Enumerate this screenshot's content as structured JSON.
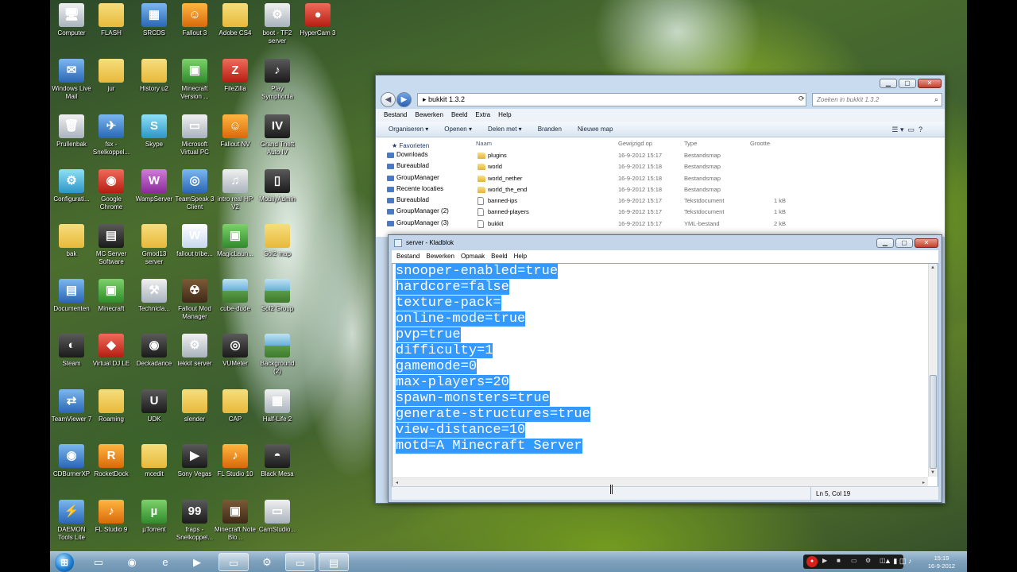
{
  "desktop_icons": [
    {
      "label": "Computer",
      "icon": "computer-icon",
      "style": "g-grey",
      "glyph": "🖥"
    },
    {
      "label": "FLASH",
      "icon": "folder-icon",
      "style": "g-folder",
      "glyph": ""
    },
    {
      "label": "SRCDS",
      "icon": "server-app-icon",
      "style": "g-blue",
      "glyph": "▦"
    },
    {
      "label": "Fallout 3",
      "icon": "fallout-icon",
      "style": "g-orange",
      "glyph": "☺"
    },
    {
      "label": "Adobe CS4",
      "icon": "folder-icon",
      "style": "g-folder",
      "glyph": ""
    },
    {
      "label": "boot - TF2 server",
      "icon": "batch-file-icon",
      "style": "g-grey",
      "glyph": "⚙"
    },
    {
      "label": "HyperCam 3",
      "icon": "hypercam-icon",
      "style": "g-red",
      "glyph": "●"
    },
    {
      "label": "Windows Live Mail",
      "icon": "mail-icon",
      "style": "g-blue",
      "glyph": "✉"
    },
    {
      "label": "jur",
      "icon": "folder-icon",
      "style": "g-folder",
      "glyph": ""
    },
    {
      "label": "History u2",
      "icon": "folder-icon",
      "style": "g-folder",
      "glyph": ""
    },
    {
      "label": "Minecraft Version ...",
      "icon": "minecraft-icon",
      "style": "g-green",
      "glyph": "▣"
    },
    {
      "label": "FileZilla",
      "icon": "filezilla-icon",
      "style": "g-red",
      "glyph": "Z"
    },
    {
      "label": "Play Symphonia",
      "icon": "music-app-icon",
      "style": "g-dark",
      "glyph": "♪"
    },
    {
      "label": "Prullenbak",
      "icon": "recycle-bin-icon",
      "style": "g-grey",
      "glyph": "🗑"
    },
    {
      "label": "fsx - Snelkoppel...",
      "icon": "airplane-icon",
      "style": "g-blue",
      "glyph": "✈"
    },
    {
      "label": "Skype",
      "icon": "skype-icon",
      "style": "g-cyan",
      "glyph": "S"
    },
    {
      "label": "Microsoft Virtual PC",
      "icon": "virtual-pc-icon",
      "style": "g-grey",
      "glyph": "▭"
    },
    {
      "label": "Fallout NV",
      "icon": "fallout-icon",
      "style": "g-orange",
      "glyph": "☺"
    },
    {
      "label": "Grand Theft Auto IV",
      "icon": "gta-icon",
      "style": "g-dark",
      "glyph": "IV"
    },
    {
      "label": "Configurati...",
      "icon": "config-icon",
      "style": "g-cyan",
      "glyph": "⚙"
    },
    {
      "label": "Google Chrome",
      "icon": "chrome-icon",
      "style": "g-red",
      "glyph": "◉"
    },
    {
      "label": "WampServer",
      "icon": "wamp-icon",
      "style": "g-purple",
      "glyph": "W"
    },
    {
      "label": "TeamSpeak 3 Client",
      "icon": "teamspeak-icon",
      "style": "g-blue",
      "glyph": "◎"
    },
    {
      "label": "intro real HP V2",
      "icon": "audio-file-icon",
      "style": "g-grey",
      "glyph": "♫"
    },
    {
      "label": "MobilyAdmin",
      "icon": "phone-icon",
      "style": "g-dark",
      "glyph": "▯"
    },
    {
      "label": "bak",
      "icon": "folder-icon",
      "style": "g-folder",
      "glyph": ""
    },
    {
      "label": "MC Server Software",
      "icon": "server-icon",
      "style": "g-dark",
      "glyph": "▤"
    },
    {
      "label": "Gmod13 server",
      "icon": "folder-icon",
      "style": "g-folder",
      "glyph": ""
    },
    {
      "label": "fallout tribe...",
      "icon": "word-document-icon",
      "style": "g-word",
      "glyph": "W"
    },
    {
      "label": "MagicLaun...",
      "icon": "minecraft-icon",
      "style": "g-green",
      "glyph": "▣"
    },
    {
      "label": "Sol2 map",
      "icon": "folder-icon",
      "style": "g-folder",
      "glyph": ""
    },
    {
      "label": "Documenten",
      "icon": "documents-icon",
      "style": "g-blue",
      "glyph": "▤"
    },
    {
      "label": "Minecraft",
      "icon": "minecraft-icon",
      "style": "g-green",
      "glyph": "▣"
    },
    {
      "label": "Technicla...",
      "icon": "tools-icon",
      "style": "g-grey",
      "glyph": "⚒"
    },
    {
      "label": "Fallout Mod Manager",
      "icon": "fallout-icon",
      "style": "g-brown",
      "glyph": "☢"
    },
    {
      "label": "cube-dude",
      "icon": "image-icon",
      "style": "g-img",
      "glyph": ""
    },
    {
      "label": "Sol2 Group",
      "icon": "image-icon",
      "style": "g-img",
      "glyph": ""
    },
    {
      "label": "Steam",
      "icon": "steam-icon",
      "style": "g-dark",
      "glyph": "◐"
    },
    {
      "label": "Virtual DJ LE",
      "icon": "dj-icon",
      "style": "g-red",
      "glyph": "◆"
    },
    {
      "label": "Deckadance",
      "icon": "deckadance-icon",
      "style": "g-dark",
      "glyph": "◉"
    },
    {
      "label": "tekkit server",
      "icon": "batch-file-icon",
      "style": "g-grey",
      "glyph": "⚙"
    },
    {
      "label": "VUMeter",
      "icon": "speaker-icon",
      "style": "g-dark",
      "glyph": "◎"
    },
    {
      "label": "Background (2)",
      "icon": "image-icon",
      "style": "g-img",
      "glyph": ""
    },
    {
      "label": "TeamViewer 7",
      "icon": "teamviewer-icon",
      "style": "g-blue",
      "glyph": "⇄"
    },
    {
      "label": "Roaming",
      "icon": "folder-icon",
      "style": "g-folder",
      "glyph": ""
    },
    {
      "label": "UDK",
      "icon": "udk-icon",
      "style": "g-dark",
      "glyph": "U"
    },
    {
      "label": "slender",
      "icon": "folder-icon",
      "style": "g-folder",
      "glyph": ""
    },
    {
      "label": "CAP",
      "icon": "folder-icon",
      "style": "g-folder",
      "glyph": ""
    },
    {
      "label": "Half-Life 2",
      "icon": "calendar-icon",
      "style": "g-grey",
      "glyph": "▦"
    },
    {
      "label": "CDBurnerXP",
      "icon": "cd-burner-icon",
      "style": "g-blue",
      "glyph": "◉"
    },
    {
      "label": "RocketDock",
      "icon": "rocketdock-icon",
      "style": "g-orange",
      "glyph": "R"
    },
    {
      "label": "mcedit",
      "icon": "folder-icon",
      "style": "g-folder",
      "glyph": ""
    },
    {
      "label": "Sony Vegas",
      "icon": "sony-vegas-icon",
      "style": "g-dark",
      "glyph": "▶"
    },
    {
      "label": "FL Studio 10",
      "icon": "fl-studio-icon",
      "style": "g-orange",
      "glyph": "♪"
    },
    {
      "label": "Black Mesa",
      "icon": "black-mesa-icon",
      "style": "g-dark",
      "glyph": "◓"
    },
    {
      "label": "DAEMON Tools Lite",
      "icon": "daemon-tools-icon",
      "style": "g-blue",
      "glyph": "⚡"
    },
    {
      "label": "FL Studio 9",
      "icon": "fl-studio-icon",
      "style": "g-orange",
      "glyph": "♪"
    },
    {
      "label": "µTorrent",
      "icon": "utorrent-icon",
      "style": "g-green",
      "glyph": "µ"
    },
    {
      "label": "fraps - Snelkoppel...",
      "icon": "fraps-icon",
      "style": "g-dark",
      "glyph": "99"
    },
    {
      "label": "Minecraft Note Blo...",
      "icon": "minecraft-icon",
      "style": "g-brown",
      "glyph": "▣"
    },
    {
      "label": "CamStudio...",
      "icon": "camstudio-icon",
      "style": "g-grey",
      "glyph": "▭"
    }
  ],
  "explorer": {
    "address": "bukkit 1.3.2",
    "search_placeholder": "Zoeken in bukkit 1.3.2",
    "menu": [
      "Bestand",
      "Bewerken",
      "Beeld",
      "Extra",
      "Help"
    ],
    "commands": [
      "Organiseren ▾",
      "Openen ▾",
      "Delen met ▾",
      "Branden",
      "Nieuwe map"
    ],
    "favorites_header": "Favorieten",
    "nav_items": [
      "Downloads",
      "Bureaublad",
      "GroupManager",
      "Recente locaties",
      "Bureaublad",
      "GroupManager (2)",
      "GroupManager (3)"
    ],
    "columns": {
      "name": "Naam",
      "date": "Gewijzigd op",
      "type": "Type",
      "size": "Grootte"
    },
    "files": [
      {
        "name": "plugins",
        "date": "16-9-2012 15:17",
        "type": "Bestandsmap",
        "size": "",
        "kind": "folder"
      },
      {
        "name": "world",
        "date": "16-9-2012 15:18",
        "type": "Bestandsmap",
        "size": "",
        "kind": "folder"
      },
      {
        "name": "world_nether",
        "date": "16-9-2012 15:18",
        "type": "Bestandsmap",
        "size": "",
        "kind": "folder"
      },
      {
        "name": "world_the_end",
        "date": "16-9-2012 15:18",
        "type": "Bestandsmap",
        "size": "",
        "kind": "folder"
      },
      {
        "name": "banned-ips",
        "date": "16-9-2012 15:17",
        "type": "Tekstdocument",
        "size": "1 kB",
        "kind": "doc"
      },
      {
        "name": "banned-players",
        "date": "16-9-2012 15:17",
        "type": "Tekstdocument",
        "size": "1 kB",
        "kind": "doc"
      },
      {
        "name": "bukkit",
        "date": "16-9-2012 15:17",
        "type": "YML-bestand",
        "size": "2 kB",
        "kind": "doc"
      }
    ]
  },
  "notepad": {
    "title": "server - Kladblok",
    "menu": [
      "Bestand",
      "Bewerken",
      "Opmaak",
      "Beeld",
      "Help"
    ],
    "lines": [
      "snooper-enabled=true",
      "hardcore=false",
      "texture-pack=",
      "online-mode=true",
      "pvp=true",
      "difficulty=1",
      "gamemode=0",
      "max-players=20",
      "spawn-monsters=true",
      "generate-structures=true",
      "view-distance=10",
      "motd=A Minecraft Server"
    ],
    "status": "Ln 5, Col 19"
  },
  "taskbar": {
    "clock_time": "15:19",
    "clock_date": "16-9-2012"
  }
}
